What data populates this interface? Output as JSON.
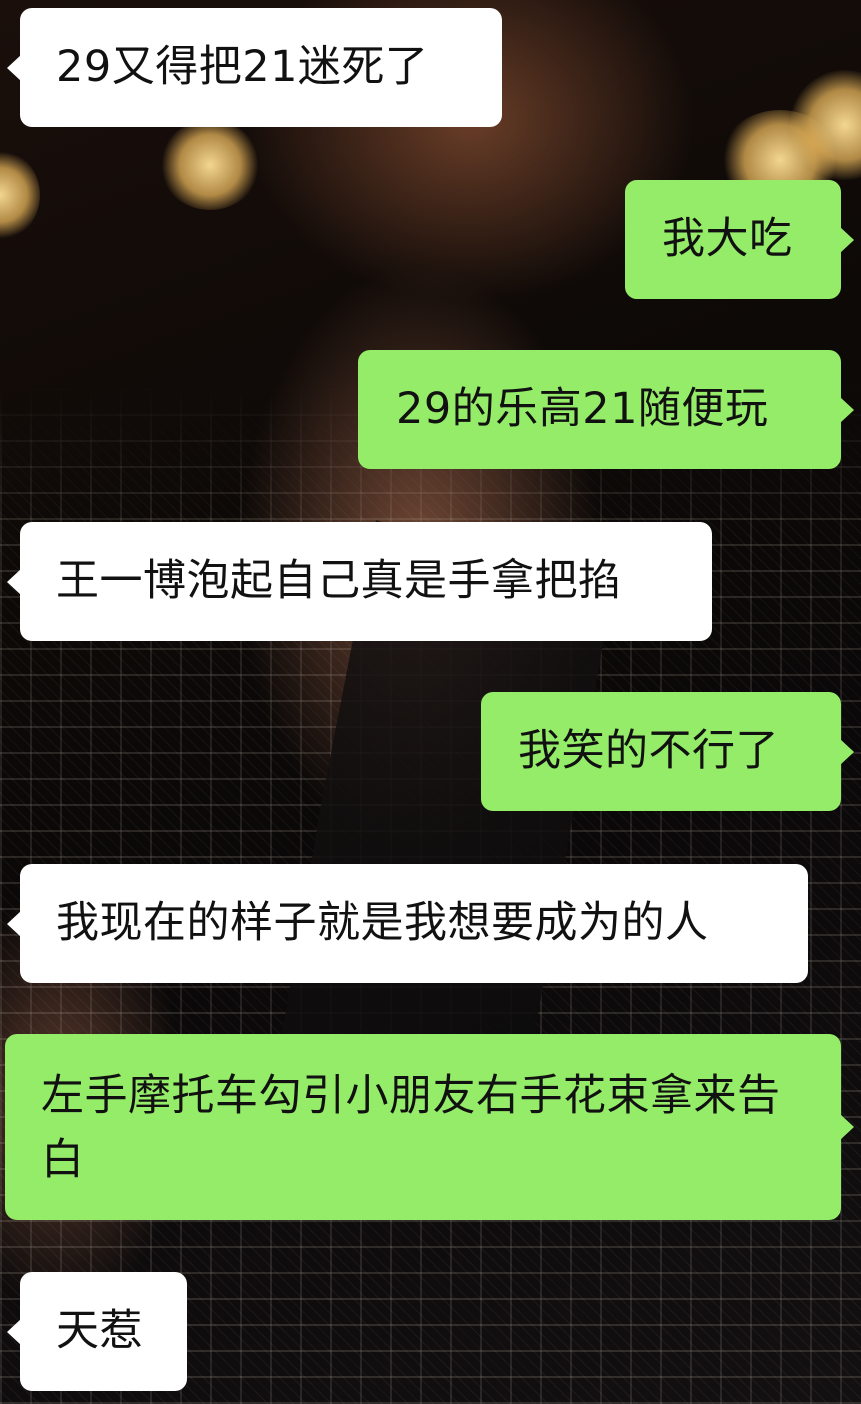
{
  "colors": {
    "incoming_bubble": "#ffffff",
    "outgoing_bubble": "#95ec69",
    "text": "#111111"
  },
  "messages": [
    {
      "side": "left",
      "text": "29又得把21迷死了"
    },
    {
      "side": "right",
      "text": "我大吃"
    },
    {
      "side": "right",
      "text": "29的乐高21随便玩"
    },
    {
      "side": "left",
      "text": "王一博泡起自己真是手拿把掐"
    },
    {
      "side": "right",
      "text": "我笑的不行了"
    },
    {
      "side": "left",
      "text": "我现在的样子就是我想要成为的人"
    },
    {
      "side": "right",
      "text": "左手摩托车勾引小朋友右手花束拿来告白"
    },
    {
      "side": "left",
      "text": "天惹"
    }
  ]
}
